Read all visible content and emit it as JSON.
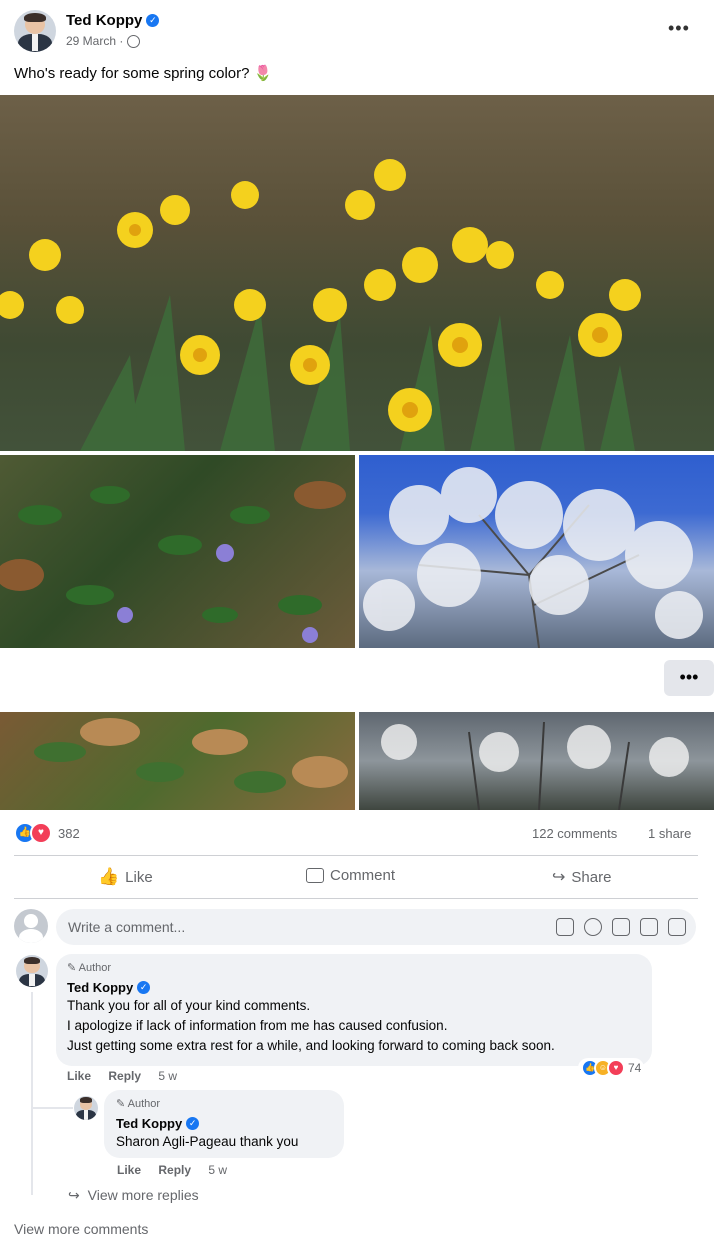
{
  "post": {
    "author": "Ted Koppy",
    "date": "29 March",
    "text": "Who's ready for some spring color? 🌷",
    "more_label": "•••",
    "overflow_label": "•••"
  },
  "stats": {
    "reactions": "382",
    "comments": "122 comments",
    "shares": "1 share"
  },
  "actions": {
    "like": "Like",
    "comment": "Comment",
    "share": "Share"
  },
  "composer": {
    "placeholder": "Write a comment..."
  },
  "comments": [
    {
      "tag": "Author",
      "name": "Ted Koppy",
      "lines": [
        "Thank you for all of your kind comments.",
        "I apologize if lack of information from me has caused confusion.",
        "Just getting some extra rest for a while, and looking forward to coming back soon."
      ],
      "like": "Like",
      "reply": "Reply",
      "time": "5 w",
      "reaction_count": "74"
    }
  ],
  "reply": {
    "tag": "Author",
    "name": "Ted Koppy",
    "text": "Sharon Agli-Pageau thank you",
    "like": "Like",
    "reply": "Reply",
    "time": "5 w"
  },
  "view_more_replies": "View more replies",
  "view_more_comments": "View more comments",
  "colors": {
    "accent": "#1877f2",
    "love": "#f33e58",
    "care": "#f7b125"
  }
}
